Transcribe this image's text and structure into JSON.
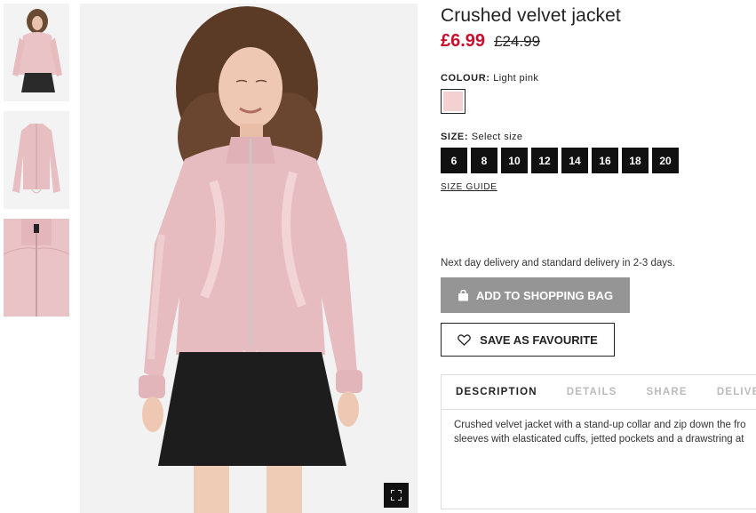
{
  "product": {
    "title": "Crushed velvet jacket",
    "price_now": "£6.99",
    "price_was": "£24.99"
  },
  "colour": {
    "label": "COLOUR:",
    "value": "Light pink",
    "swatch_color": "#f3d0d2"
  },
  "size": {
    "label": "SIZE:",
    "value": "Select size",
    "options": [
      "6",
      "8",
      "10",
      "12",
      "14",
      "16",
      "18",
      "20"
    ],
    "guide_label": "SIZE GUIDE"
  },
  "delivery_note": "Next day delivery and standard delivery in 2-3 days.",
  "buttons": {
    "add_to_bag": "ADD TO SHOPPING BAG",
    "save_favourite": "SAVE AS FAVOURITE"
  },
  "tabs": [
    "DESCRIPTION",
    "DETAILS",
    "SHARE",
    "DELIVERY"
  ],
  "description": {
    "line1": "Crushed velvet jacket with a stand-up collar and zip down the fro",
    "line2": "sleeves with elasticated cuffs, jetted pockets and a drawstring at"
  },
  "icons": {
    "bag": "shopping-bag-icon",
    "heart": "heart-icon",
    "zoom": "fullscreen-icon"
  },
  "colors": {
    "sale_price": "#c8102e",
    "size_button": "#111111",
    "add_button": "#959595",
    "inactive_tab": "#bbbbbb"
  }
}
